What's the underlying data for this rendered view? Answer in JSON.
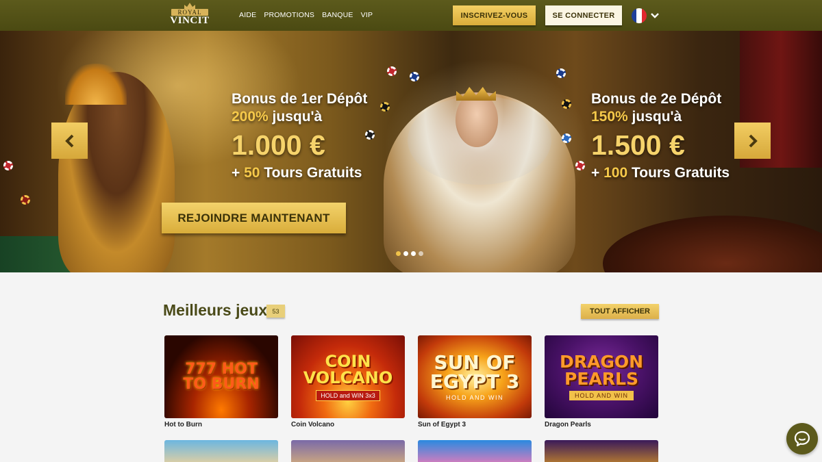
{
  "header": {
    "logo_top": "ROYAL",
    "logo_bottom": "VINCIT",
    "nav": [
      {
        "label": "AIDE"
      },
      {
        "label": "PROMOTIONS"
      },
      {
        "label": "BANQUE"
      },
      {
        "label": "VIP"
      }
    ],
    "register_label": "INSCRIVEZ-VOUS",
    "login_label": "SE CONNECTER",
    "language": {
      "icon": "flag-france-icon",
      "colors": [
        "#1f3f9a",
        "#ffffff",
        "#e0262e"
      ]
    }
  },
  "hero": {
    "promo_left": {
      "line1": "Bonus de 1er Dépôt",
      "percent": "200%",
      "upto": " jusqu'à",
      "amount": "1.000 €",
      "spins_prefix": "+ ",
      "spins_count": "50",
      "spins_suffix": " Tours Gratuits"
    },
    "promo_right": {
      "line1": "Bonus de 2e Dépôt",
      "percent": "150%",
      "upto": " jusqu'à",
      "amount": "1.500 €",
      "spins_prefix": "+ ",
      "spins_count": "100",
      "spins_suffix": " Tours Gratuits"
    },
    "join_label": "REJOINDRE MAINTENANT",
    "carousel_dots": 4,
    "active_dot": 0
  },
  "games": {
    "title": "Meilleurs jeux",
    "count": "53",
    "view_all_label": "TOUT AFFICHER",
    "items": [
      {
        "name": "Hot to Burn",
        "thumb_title": "777 HOT TO BURN"
      },
      {
        "name": "Coin Volcano",
        "thumb_title": "COIN VOLCANO",
        "thumb_sub": "HOLD and WIN 3x3"
      },
      {
        "name": "Sun of Egypt 3",
        "thumb_title": "SUN OF EGYPT 3",
        "thumb_sub": "HOLD AND WIN"
      },
      {
        "name": "Dragon Pearls",
        "thumb_title": "DRAGON PEARLS",
        "thumb_sub": "HOLD AND WIN"
      }
    ]
  },
  "colors": {
    "header_bg": "#4f4d15",
    "gold": "#e6bc4a",
    "title_text": "#4a4a18"
  }
}
